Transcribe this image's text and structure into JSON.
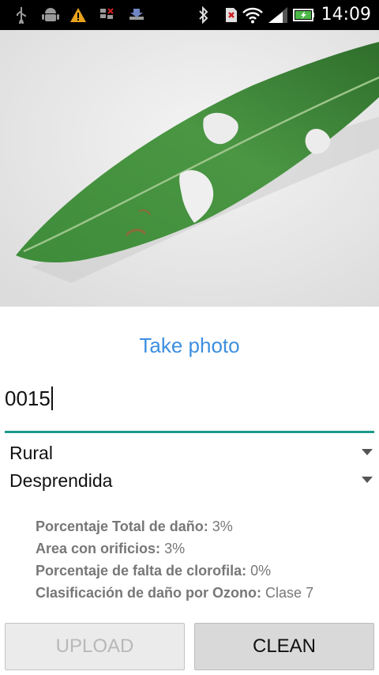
{
  "status_bar": {
    "time": "14:09",
    "icons": [
      "usb-icon",
      "android-debug-icon",
      "warning-icon",
      "sim-error-icon",
      "download-icon",
      "bluetooth-icon",
      "no-sim-icon",
      "wifi-icon",
      "signal-icon",
      "battery-charging-icon"
    ]
  },
  "photo": {
    "subject": "leaf-photo"
  },
  "take_photo_label": "Take photo",
  "id_input": {
    "value": "0015"
  },
  "spinner_zone": {
    "value": "Rural"
  },
  "spinner_state": {
    "value": "Desprendida"
  },
  "results": [
    {
      "label": "Porcentaje Total de daño:",
      "value": "3%"
    },
    {
      "label": "Area con orificios:",
      "value": "3%"
    },
    {
      "label": "Porcentaje de falta de clorofila:",
      "value": "0%"
    },
    {
      "label": "Clasificación de daño por Ozono:",
      "value": "Clase 7"
    }
  ],
  "buttons": {
    "upload": "UPLOAD",
    "clean": "CLEAN"
  },
  "colors": {
    "accent_blue": "#3d8fe0",
    "input_line": "#1e9a8a",
    "leaf_green": "#3f8a3a"
  }
}
